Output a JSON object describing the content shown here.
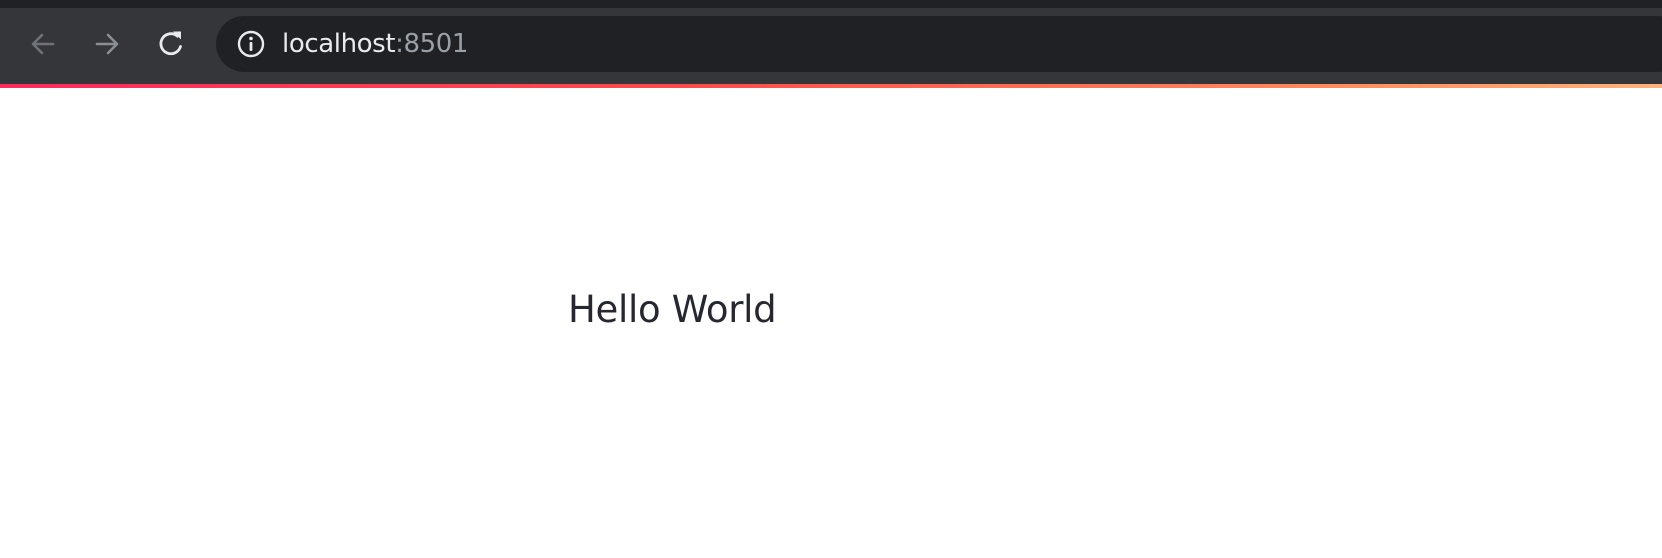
{
  "browser": {
    "address": {
      "host": "localhost",
      "port": ":8501"
    },
    "icons": {
      "back": "arrow-left-icon",
      "forward": "arrow-right-icon",
      "reload": "reload-icon",
      "info": "info-icon"
    },
    "colors": {
      "chrome_bg": "#35363a",
      "address_bg": "#202124",
      "host_text": "#e8eaed",
      "port_text": "#9aa0a6",
      "accent_start": "#ff2b5e",
      "accent_end": "#ffb37a"
    }
  },
  "page": {
    "text": "Hello World",
    "text_color": "#262730",
    "background": "#ffffff"
  }
}
